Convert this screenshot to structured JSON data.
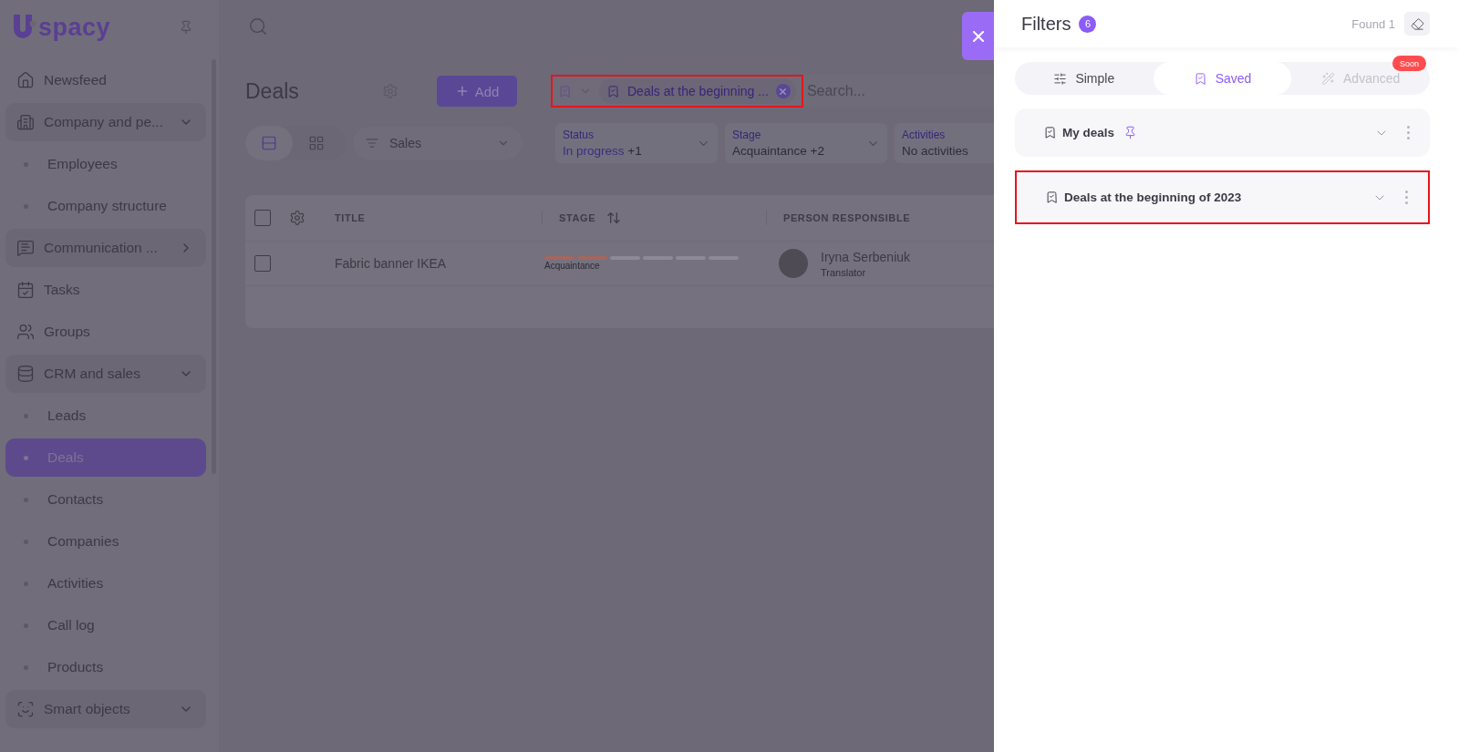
{
  "logo": {
    "text": "spacy"
  },
  "sidebar": {
    "items": [
      {
        "label": "Newsfeed",
        "kind": "link",
        "selected": false
      },
      {
        "label": "Company and pe...",
        "kind": "group",
        "expanded": true,
        "selected": false,
        "children": [
          {
            "label": "Employees",
            "selected": false
          },
          {
            "label": "Company structure",
            "selected": false
          }
        ]
      },
      {
        "label": "Communication ...",
        "kind": "group",
        "expanded": false,
        "selected": false
      },
      {
        "label": "Tasks",
        "kind": "link",
        "selected": false
      },
      {
        "label": "Groups",
        "kind": "link",
        "selected": false
      },
      {
        "label": "CRM and sales",
        "kind": "group",
        "expanded": true,
        "selected": false,
        "children": [
          {
            "label": "Leads",
            "selected": false
          },
          {
            "label": "Deals",
            "selected": true
          },
          {
            "label": "Contacts",
            "selected": false
          },
          {
            "label": "Companies",
            "selected": false
          },
          {
            "label": "Activities",
            "selected": false
          },
          {
            "label": "Call log",
            "selected": false
          },
          {
            "label": "Products",
            "selected": false
          }
        ]
      },
      {
        "label": "Smart objects",
        "kind": "group",
        "expanded": true,
        "selected": false
      }
    ]
  },
  "page": {
    "title": "Deals",
    "add_button": "Add"
  },
  "search": {
    "saved_chip": "Deals at the beginning ...",
    "placeholder": "Search...",
    "highlighted": true
  },
  "view_toggle": [
    {
      "selected": true
    },
    {
      "selected": false
    }
  ],
  "pipeline": {
    "value": "Sales"
  },
  "filters": [
    {
      "label": "Status",
      "value": "In progress",
      "extra": "+1",
      "active": false
    },
    {
      "label": "Stage",
      "value": "Acquaintance",
      "extra": "+2",
      "active": true
    },
    {
      "label": "Activities",
      "value": "No activities",
      "active": true
    }
  ],
  "table": {
    "header_checked": false,
    "columns": [
      {
        "label": "TITLE",
        "sorted": false
      },
      {
        "label": "STAGE",
        "sorted": true
      },
      {
        "label": "PERSON RESPONSIBLE",
        "sorted": false
      }
    ],
    "rows": [
      {
        "checked": false,
        "title": "Fabric banner IKEA",
        "stage": {
          "label": "Acquaintance",
          "level": 0.333
        },
        "person": {
          "name": "Iryna Serbeniuk",
          "role": "Translator"
        }
      }
    ]
  },
  "drawer": {
    "title": "Filters",
    "count": "6",
    "found": "Found 1",
    "tabs": [
      {
        "label": "Simple",
        "selected": false,
        "disabled": false
      },
      {
        "label": "Saved",
        "selected": true,
        "disabled": false
      },
      {
        "label": "Advanced",
        "selected": false,
        "disabled": true,
        "badge": "Soon"
      }
    ],
    "saved_filters": [
      {
        "name": "My deals",
        "pinned": true,
        "highlighted": false
      },
      {
        "name": "Deals at the beginning of 2023",
        "pinned": false,
        "highlighted": true
      }
    ]
  }
}
